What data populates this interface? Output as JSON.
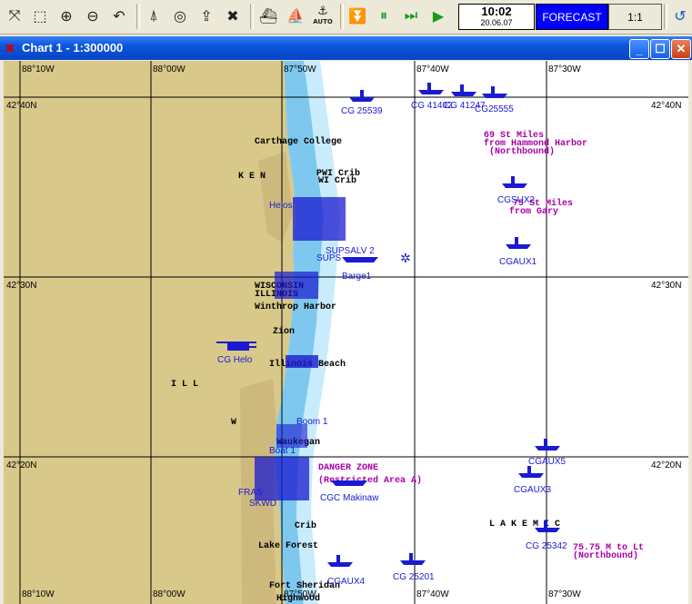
{
  "toolbar": {
    "tools": [
      {
        "name": "fit-chart-icon",
        "glyph": "⤧"
      },
      {
        "name": "zoom-box-icon",
        "glyph": "⬚"
      },
      {
        "name": "zoom-in-icon",
        "glyph": "⊕"
      },
      {
        "name": "zoom-out-icon",
        "glyph": "⊖"
      },
      {
        "name": "undo-view-icon",
        "glyph": "↶"
      },
      {
        "name": "compass-icon",
        "glyph": "⍋"
      },
      {
        "name": "center-icon",
        "glyph": "◎"
      },
      {
        "name": "export-icon",
        "glyph": "⇪"
      },
      {
        "name": "delete-icon",
        "glyph": "✖"
      },
      {
        "name": "ship-track-icon",
        "glyph": "⛴"
      },
      {
        "name": "vessel-icon",
        "glyph": "⛵"
      },
      {
        "name": "auto-vessel-icon",
        "glyph": "⚓"
      },
      {
        "name": "stop-icon",
        "glyph": "⏬"
      },
      {
        "name": "pause-icon",
        "glyph": "⏸"
      },
      {
        "name": "fast-forward-icon",
        "glyph": "⏭"
      },
      {
        "name": "play-icon",
        "glyph": "▶"
      },
      {
        "name": "sync-icon",
        "glyph": "↺"
      }
    ],
    "auto_label": "AUTO",
    "clock_time": "10:02",
    "clock_date": "20.06.07",
    "forecast_label": "FORECAST",
    "scale_label": "1:1"
  },
  "window": {
    "title": "Chart 1 - 1:300000",
    "minimize": "_",
    "maximize": "☐",
    "close": "✕"
  },
  "chart": {
    "lon_labels": [
      "88°10W",
      "88°00W",
      "87°50W",
      "87°40W",
      "87°30W"
    ],
    "lat_labels": [
      "42°40N",
      "42°30N",
      "42°20N"
    ],
    "places": [
      "Carthage College",
      "K E N",
      "PWI Crib",
      "WI Crib",
      "WISCONSIN",
      "ILLINOIS",
      "Winthrop Harbor",
      "Zion",
      "Illinois Beach",
      "I L L",
      "W",
      "L A K E   M I C",
      "Lake Forest",
      "Fort Sheridan",
      "Highwood",
      "Waukegan",
      "Crib"
    ],
    "zones": [
      "69 St Miles",
      "from Hammond Harbor",
      "(Northbound)",
      "75 St Miles",
      "from Gary",
      "DANGER ZONE",
      "(Restricted Area A)",
      "75.75 M to Lt",
      "(Northbound)"
    ],
    "vessels": [
      "CG 25539",
      "CG 41402",
      "CG 41247",
      "CG25555",
      "CGSUX2",
      "CGAUX1",
      "CGAUX5",
      "CGAUX3",
      "CG 25342",
      "CG 25201",
      "CGC Makinaw",
      "CG Helo",
      "SUPSALV 2",
      "SUPS",
      "Barge1",
      "CGAUX4",
      "Boat 1",
      "Helos",
      "FRAS",
      "SKWD",
      "Boom 1"
    ]
  },
  "colors": {
    "land": "#d8c98a",
    "water": "#ffffff",
    "shallow": "#7ec8f0",
    "vessel": "#1a1ad0",
    "zone": "#aa00aa",
    "forecast": "#0000ff"
  }
}
